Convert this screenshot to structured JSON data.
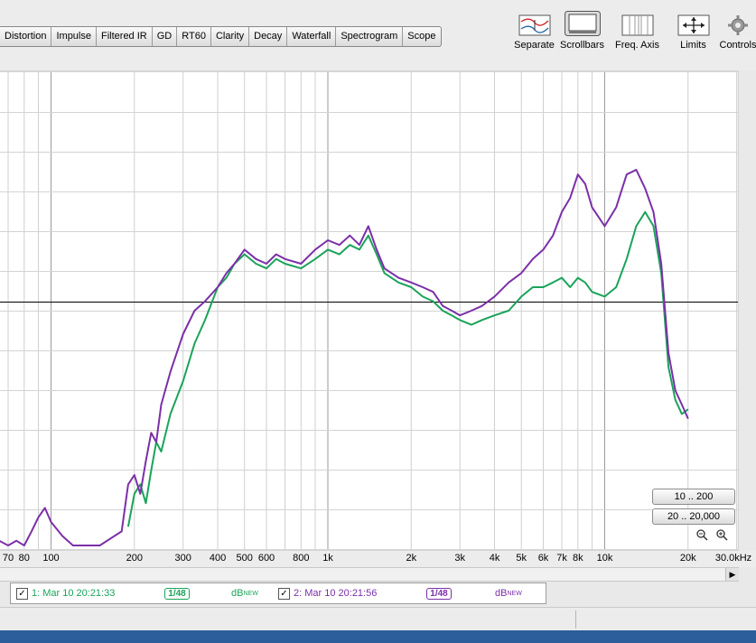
{
  "tabs": [
    "Distortion",
    "Impulse",
    "Filtered IR",
    "GD",
    "RT60",
    "Clarity",
    "Decay",
    "Waterfall",
    "Spectrogram",
    "Scope"
  ],
  "tools": [
    {
      "label": "Separate",
      "icon": "separate-icon"
    },
    {
      "label": "Scrollbars",
      "icon": "scrollbars-icon"
    },
    {
      "label": "Freq. Axis",
      "icon": "freq-axis-icon"
    },
    {
      "label": "Limits",
      "icon": "limits-icon"
    },
    {
      "label": "Controls",
      "icon": "gear-icon"
    }
  ],
  "x_axis": {
    "ticks": [
      {
        "f": 70,
        "label": "70"
      },
      {
        "f": 80,
        "label": "80"
      },
      {
        "f": 100,
        "label": "100"
      },
      {
        "f": 200,
        "label": "200"
      },
      {
        "f": 300,
        "label": "300"
      },
      {
        "f": 400,
        "label": "400"
      },
      {
        "f": 500,
        "label": "500"
      },
      {
        "f": 600,
        "label": "600"
      },
      {
        "f": 800,
        "label": "800"
      },
      {
        "f": 1000,
        "label": "1k"
      },
      {
        "f": 2000,
        "label": "2k"
      },
      {
        "f": 3000,
        "label": "3k"
      },
      {
        "f": 4000,
        "label": "4k"
      },
      {
        "f": 5000,
        "label": "5k"
      },
      {
        "f": 6000,
        "label": "6k"
      },
      {
        "f": 7000,
        "label": "7k"
      },
      {
        "f": 8000,
        "label": "8k"
      },
      {
        "f": 10000,
        "label": "10k"
      },
      {
        "f": 20000,
        "label": "20k"
      },
      {
        "f": 30000,
        "label": "30.0kHz"
      }
    ]
  },
  "range_buttons": [
    "10 .. 200",
    "20 .. 20,000"
  ],
  "legend": [
    {
      "checked": "✓",
      "name": "1: Mar 10 20:21:33",
      "smoothing": "1/48",
      "unit": "dB",
      "unit_sup": "NEW",
      "color": "#1aa35a"
    },
    {
      "checked": "✓",
      "name": "2: Mar 10 20:21:56",
      "smoothing": "1/48",
      "unit": "dB",
      "unit_sup": "NEW",
      "color": "#7b2fa8"
    }
  ],
  "chart_data": {
    "type": "line",
    "x_scale": "log",
    "xlim": [
      60,
      30000
    ],
    "ylim": [
      0,
      100
    ],
    "reference_line": 52,
    "series": [
      {
        "name": "1: Mar 10 20:21:33",
        "color": "#1aa35a",
        "x": [
          190,
          200,
          210,
          220,
          230,
          240,
          250,
          270,
          300,
          330,
          360,
          400,
          430,
          460,
          500,
          550,
          600,
          650,
          700,
          800,
          900,
          1000,
          1100,
          1200,
          1300,
          1400,
          1500,
          1600,
          1800,
          2000,
          2200,
          2400,
          2600,
          2800,
          3000,
          3300,
          3600,
          4000,
          4500,
          5000,
          5500,
          6000,
          6500,
          7000,
          7500,
          8000,
          8500,
          9000,
          10000,
          11000,
          12000,
          13000,
          14000,
          15000,
          16000,
          17000,
          18000,
          19000,
          20000
        ],
        "y": [
          4,
          11,
          13,
          9,
          16,
          22,
          20,
          28,
          35,
          43,
          48,
          55,
          57,
          60,
          62,
          60,
          59,
          61,
          60,
          59,
          61,
          63,
          62,
          64,
          63,
          66,
          62,
          58,
          56,
          55,
          53,
          52,
          50,
          49,
          48,
          47,
          48,
          49,
          50,
          53,
          55,
          55,
          56,
          57,
          55,
          57,
          56,
          54,
          53,
          55,
          61,
          68,
          71,
          68,
          58,
          38,
          31,
          28,
          29
        ]
      },
      {
        "name": "2: Mar 10 20:21:56",
        "color": "#7b2fa8",
        "x": [
          65,
          70,
          75,
          80,
          85,
          90,
          95,
          100,
          110,
          120,
          150,
          180,
          190,
          200,
          210,
          220,
          230,
          240,
          250,
          270,
          300,
          330,
          360,
          400,
          430,
          460,
          500,
          550,
          600,
          650,
          700,
          800,
          900,
          1000,
          1100,
          1200,
          1300,
          1400,
          1500,
          1600,
          1800,
          2000,
          2200,
          2400,
          2600,
          2800,
          3000,
          3300,
          3600,
          4000,
          4500,
          5000,
          5500,
          6000,
          6500,
          7000,
          7500,
          8000,
          8500,
          9000,
          10000,
          11000,
          12000,
          13000,
          14000,
          15000,
          16000,
          17000,
          18000,
          19000,
          20000
        ],
        "y": [
          1,
          0,
          1,
          0,
          3,
          6,
          8,
          5,
          2,
          0,
          0,
          3,
          13,
          15,
          11,
          18,
          24,
          22,
          30,
          37,
          45,
          50,
          52,
          55,
          58,
          60,
          63,
          61,
          60,
          62,
          61,
          60,
          63,
          65,
          64,
          66,
          64,
          68,
          63,
          59,
          57,
          56,
          55,
          54,
          51,
          50,
          49,
          50,
          51,
          53,
          56,
          58,
          61,
          63,
          66,
          71,
          74,
          79,
          77,
          72,
          68,
          72,
          79,
          80,
          76,
          71,
          60,
          41,
          33,
          30,
          27
        ]
      }
    ]
  }
}
